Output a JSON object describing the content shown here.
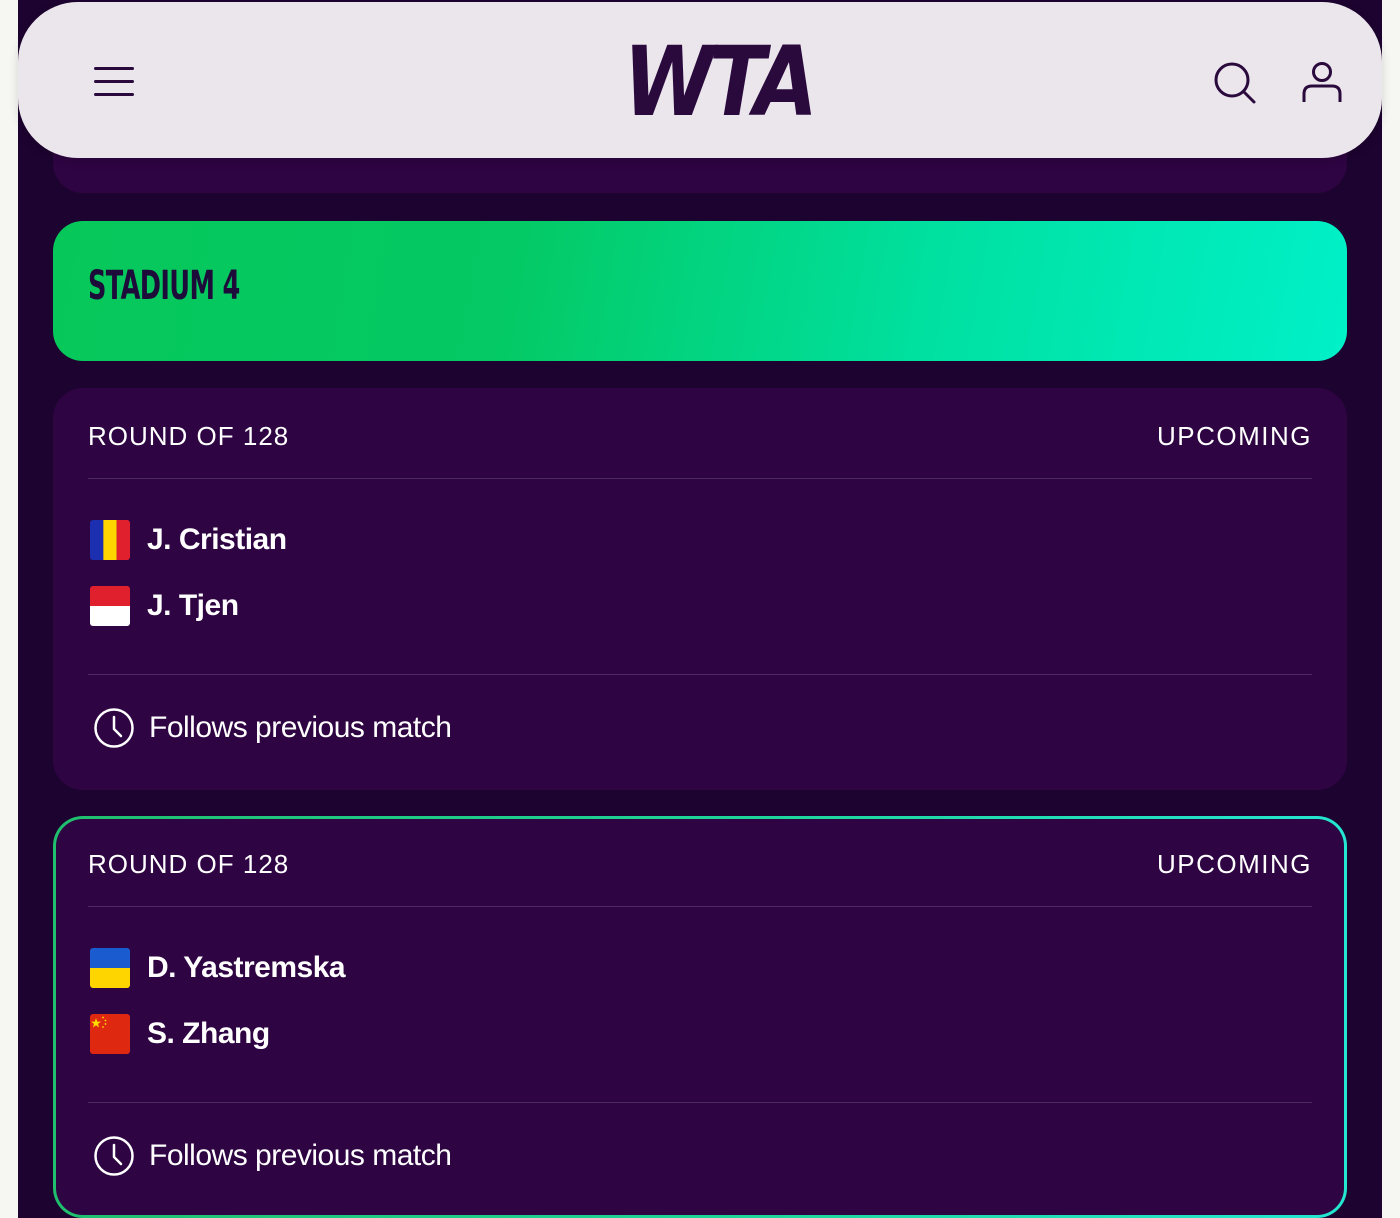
{
  "header": {
    "logo_text": "WTA",
    "menu_icon": "hamburger-menu-icon",
    "search_icon": "search-icon",
    "account_icon": "user-icon"
  },
  "colors": {
    "background": "#1d0330",
    "card": "#2e0442",
    "accent_green": "#04c964",
    "accent_teal": "#00f0c8",
    "header": "#ebe5ec"
  },
  "court": {
    "name": "STADIUM 4"
  },
  "matches": [
    {
      "round": "ROUND OF 128",
      "status": "UPCOMING",
      "players": [
        {
          "name": "J. Cristian",
          "flag": "romania-flag"
        },
        {
          "name": "J. Tjen",
          "flag": "indonesia-flag"
        }
      ],
      "time_icon": "clock-icon",
      "time": "Follows previous match"
    },
    {
      "round": "ROUND OF 128",
      "status": "UPCOMING",
      "players": [
        {
          "name": "D. Yastremska",
          "flag": "ukraine-flag"
        },
        {
          "name": "S. Zhang",
          "flag": "china-flag"
        }
      ],
      "time_icon": "clock-icon",
      "time": "Follows previous match"
    }
  ]
}
